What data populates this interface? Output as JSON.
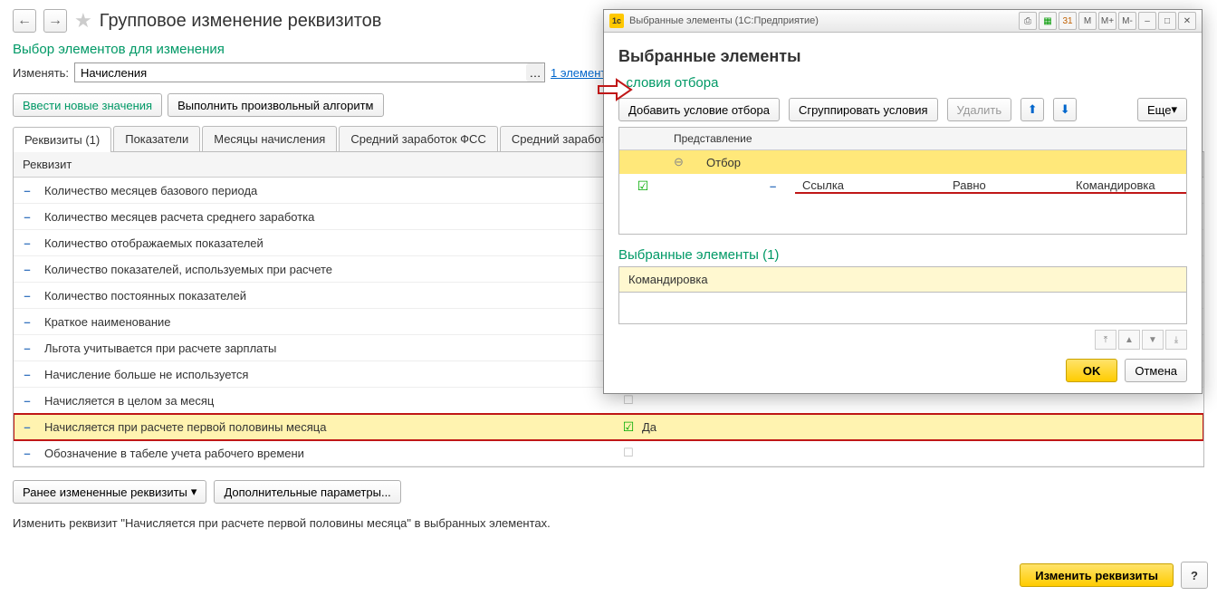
{
  "header": {
    "title": "Групповое изменение реквизитов"
  },
  "selection_section": {
    "title": "Выбор элементов для изменения",
    "change_label": "Изменять:",
    "change_value": "Начисления",
    "elements_link": "1 элемент"
  },
  "toolbar": {
    "enter_values": "Ввести новые значения",
    "run_algorithm": "Выполнить произвольный алгоритм"
  },
  "tabs": [
    {
      "label": "Реквизиты (1)"
    },
    {
      "label": "Показатели"
    },
    {
      "label": "Месяцы начисления"
    },
    {
      "label": "Средний заработок ФСС"
    },
    {
      "label": "Средний заработок общ..."
    }
  ],
  "grid": {
    "header": "Реквизит",
    "rows": [
      {
        "name": "Количество месяцев базового периода",
        "checked": false,
        "value": ""
      },
      {
        "name": "Количество месяцев расчета среднего заработка",
        "checked": false,
        "value": ""
      },
      {
        "name": "Количество отображаемых показателей",
        "checked": false,
        "value": ""
      },
      {
        "name": "Количество показателей, используемых при расчете",
        "checked": false,
        "value": ""
      },
      {
        "name": "Количество постоянных показателей",
        "checked": false,
        "value": ""
      },
      {
        "name": "Краткое наименование",
        "checked": false,
        "value": ""
      },
      {
        "name": "Льгота учитывается при расчете зарплаты",
        "checked": false,
        "value": ""
      },
      {
        "name": "Начисление больше не используется",
        "checked": false,
        "value": ""
      },
      {
        "name": "Начисляется в целом за месяц",
        "checked": false,
        "value": ""
      },
      {
        "name": "Начисляется при расчете первой половины месяца",
        "checked": true,
        "value": "Да",
        "selected": true
      },
      {
        "name": "Обозначение в табеле учета рабочего времени",
        "checked": false,
        "value": ""
      }
    ]
  },
  "footer_buttons": {
    "prev_changed": "Ранее измененные реквизиты",
    "extra_params": "Дополнительные параметры..."
  },
  "status_text": "Изменить реквизит \"Начисляется при расчете первой половины месяца\" в выбранных элементах.",
  "action_button": "Изменить реквизиты",
  "help": "?",
  "dialog": {
    "titlebar": "Выбранные элементы  (1С:Предприятие)",
    "tb_icons": [
      "M",
      "M+",
      "M-"
    ],
    "heading": "Выбранные элементы",
    "cond_section": "словия отбора",
    "add_cond": "Добавить условие отбора",
    "group_cond": "Сгруппировать условия",
    "delete": "Удалить",
    "more": "Еще",
    "cond_header": "Представление",
    "cond_group": "Отбор",
    "cond_row": {
      "field": "Ссылка",
      "op": "Равно",
      "val": "Командировка"
    },
    "selected_section": "Выбранные элементы (1)",
    "selected_item": "Командировка",
    "ok": "OK",
    "cancel": "Отмена"
  }
}
